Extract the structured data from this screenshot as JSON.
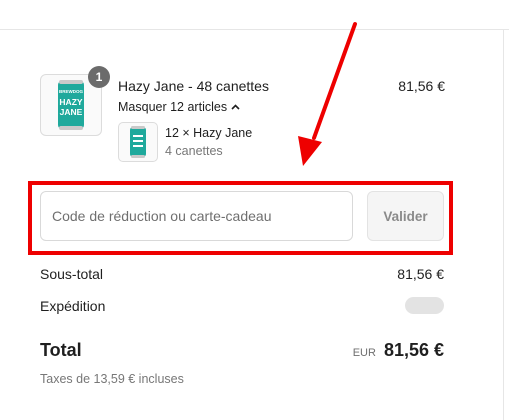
{
  "product": {
    "name": "Hazy Jane - 48 canettes",
    "price": "81,56 €",
    "quantity_badge": "1",
    "toggle_label": "Masquer 12 articles",
    "can_text": {
      "brand": "BREWDOG",
      "line1": "HAZY",
      "line2": "JANE"
    },
    "subitem": {
      "name": "12 × Hazy Jane",
      "quantity": "4 canettes"
    }
  },
  "discount": {
    "placeholder": "Code de réduction ou carte-cadeau",
    "value": "",
    "apply_label": "Valider"
  },
  "summary": {
    "subtotal_label": "Sous-total",
    "subtotal_value": "81,56 €",
    "shipping_label": "Expédition",
    "total_label": "Total",
    "currency": "EUR",
    "total_value": "81,56 €",
    "taxes_note": "Taxes de 13,59 € incluses"
  },
  "colors": {
    "highlight": "#ee0000",
    "can_teal": "#1fa99c",
    "arrow": "#ee0000"
  },
  "icons": {
    "toggle": "chevron-up-icon",
    "annotation": "arrow-icon"
  }
}
